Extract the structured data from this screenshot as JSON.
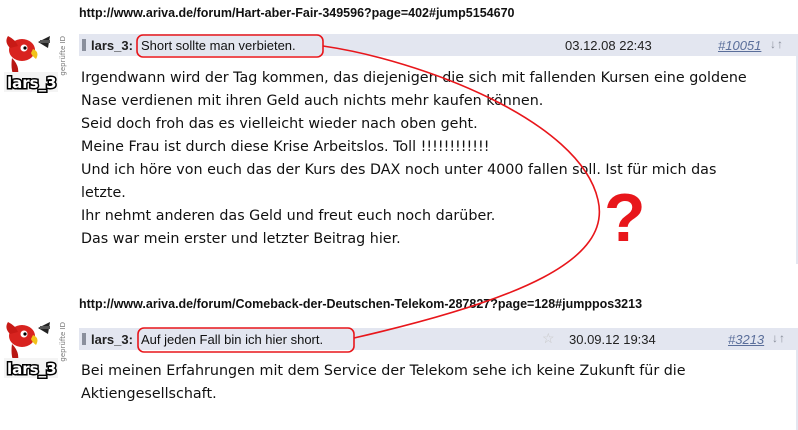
{
  "posts": [
    {
      "url": "http://www.ariva.de/forum/Hart-aber-Fair-349596?page=402#jump5154670",
      "author": "lars_3",
      "author_colon": ":",
      "subject": "Short sollte man verbieten.",
      "date": "03.12.08 22:43",
      "post_no": "#10051",
      "arrows": "↓↑",
      "body": [
        "Irgendwann wird der Tag kommen, das diejenigen die sich mit fallenden Kursen eine goldene",
        "Nase verdienen mit ihren Geld auch nichts mehr kaufen können.",
        "Seid doch froh das es vielleicht wieder nach oben geht.",
        "Meine Frau ist durch diese Krise Arbeitslos. Toll !!!!!!!!!!!!",
        "Und ich höre von euch das der Kurs des DAX noch unter 4000 fallen soll. Ist für mich das",
        "letzte.",
        "Ihr nehmt anderen das Geld und freut euch noch darüber.",
        "Das war mein erster und letzter Beitrag hier."
      ]
    },
    {
      "url": "http://www.ariva.de/forum/Comeback-der-Deutschen-Telekom-287827?page=128#jumppos3213",
      "author": "lars_3",
      "author_colon": ":",
      "subject": "Auf jeden Fall bin ich hier short.",
      "date": "30.09.12 19:34",
      "post_no": "#3213",
      "arrows": "↓↑",
      "star": "☆",
      "body": [
        "Bei meinen Erfahrungen mit dem Service der Telekom sehe ich keine Zukunft für die",
        "Aktiengesellschaft."
      ]
    }
  ],
  "avatar": {
    "name_text": "lars_3",
    "vertical_text": "geprüfte ID"
  },
  "annotation": {
    "question_mark": "?",
    "color": "#e8161b"
  },
  "colors": {
    "header_bg": "#e3e6f0",
    "link": "#5a6e9a"
  }
}
